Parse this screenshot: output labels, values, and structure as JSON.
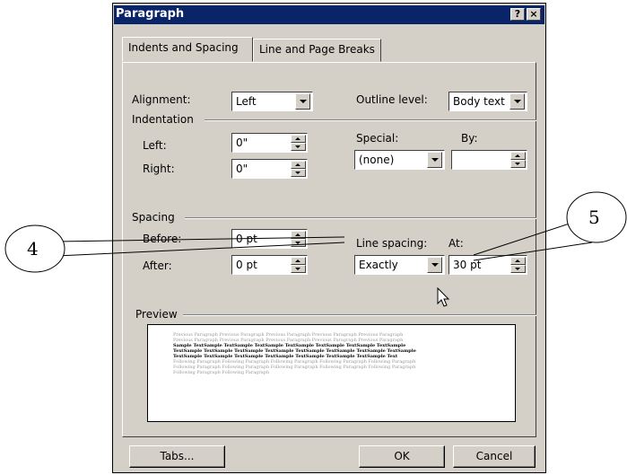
{
  "dialog": {
    "title": "Paragraph",
    "help_button": "?",
    "close_button": "×"
  },
  "tabs": [
    {
      "label": "Indents and Spacing"
    },
    {
      "label": "Line and Page Breaks"
    }
  ],
  "alignment": {
    "label": "Alignment:",
    "value": "Left"
  },
  "outline_level": {
    "label": "Outline level:",
    "value": "Body text"
  },
  "indentation": {
    "section_label": "Indentation",
    "left_label": "Left:",
    "left_value": "0\"",
    "right_label": "Right:",
    "right_value": "0\"",
    "special_label": "Special:",
    "special_value": "(none)",
    "by_label": "By:",
    "by_value": ""
  },
  "spacing": {
    "section_label": "Spacing",
    "before_label": "Before:",
    "before_value": "0 pt",
    "after_label": "After:",
    "after_value": "0 pt",
    "line_spacing_label": "Line spacing:",
    "line_spacing_value": "Exactly",
    "at_label": "At:",
    "at_value": "30 pt"
  },
  "preview": {
    "section_label": "Preview",
    "lines": [
      "Previous Paragraph Previous Paragraph Previous Paragraph Previous Paragraph Previous Paragraph",
      "Previous Paragraph Previous Paragraph Previous Paragraph Previous Paragraph Previous Paragraph",
      "Sample TextSample TextSample TextSample TextSample TextSample TextSample TextSample",
      "TextSample TextSample TextSample TextSample TextSample TextSample TextSample TextSample",
      "TextSample TextSample TextSample TextSample TextSample TextSample TextSample Text",
      "Following Paragraph Following Paragraph Following Paragraph Following Paragraph Following Paragraph",
      "Following Paragraph Following Paragraph Following Paragraph Following Paragraph Following Paragraph",
      "Following Paragraph Following Paragraph"
    ]
  },
  "buttons": {
    "tabs": "Tabs...",
    "ok": "OK",
    "cancel": "Cancel"
  },
  "callouts": {
    "left_number": "4",
    "right_number": "5"
  }
}
